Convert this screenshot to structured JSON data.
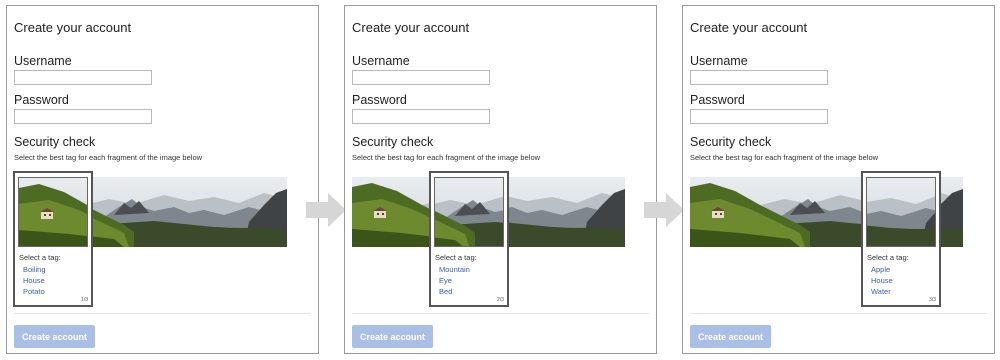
{
  "colors": {
    "tag_link": "#3a5fb0",
    "button_bg": "#a9bfe6",
    "arrow": "#d6d6d6"
  },
  "form": {
    "title": "Create your account",
    "username_label": "Username",
    "password_label": "Password",
    "security_title": "Security check",
    "instruction": "Select the best tag for each fragment of the image below",
    "submit_label": "Create account"
  },
  "steps": [
    {
      "select_label": "Select a tag:",
      "tags": [
        "Boiling",
        "House",
        "Potato"
      ],
      "counter": "1/3"
    },
    {
      "select_label": "Select a tag:",
      "tags": [
        "Mountain",
        "Eye",
        "Bed"
      ],
      "counter": "2/3"
    },
    {
      "select_label": "Select a tag:",
      "tags": [
        "Apple",
        "House",
        "Water"
      ],
      "counter": "3/3"
    }
  ],
  "icons": {
    "arrow": "right-arrow-icon"
  }
}
